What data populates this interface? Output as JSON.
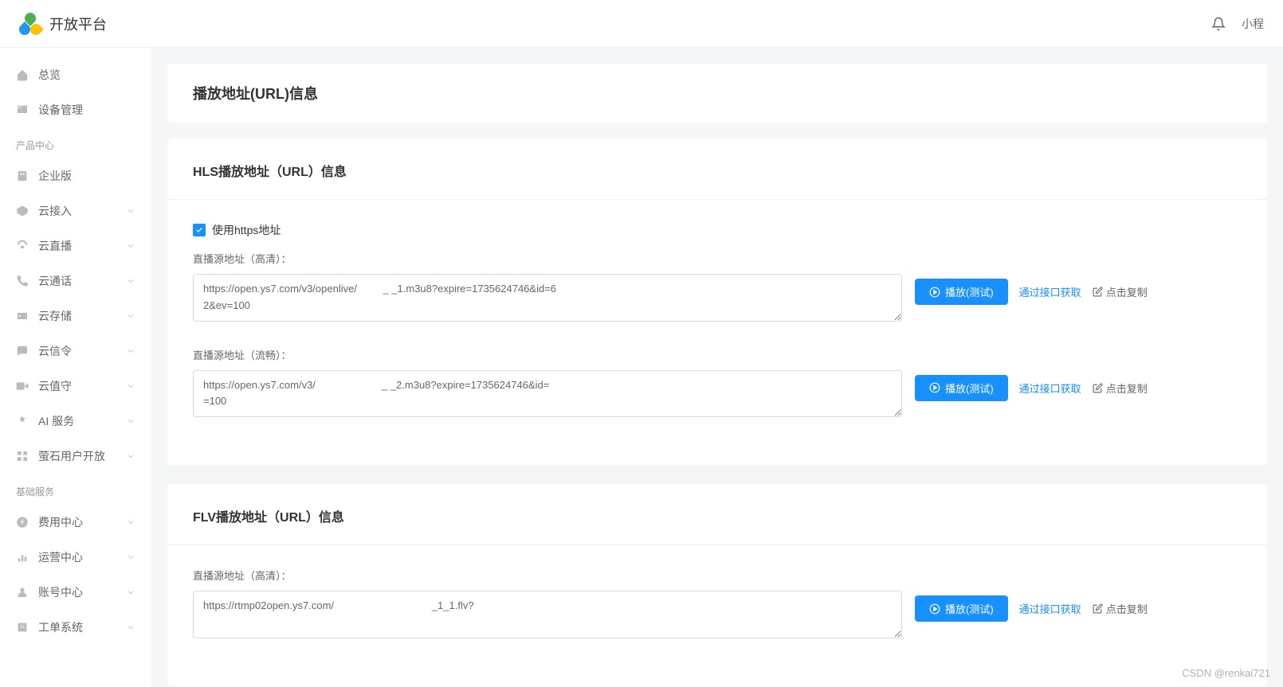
{
  "header": {
    "title": "开放平台",
    "user_text": "小程"
  },
  "sidebar": {
    "items_top": [
      {
        "icon": "home",
        "label": "总览"
      },
      {
        "icon": "device",
        "label": "设备管理"
      }
    ],
    "section1_title": "产品中心",
    "items_product": [
      {
        "icon": "enterprise",
        "label": "企业版",
        "expandable": false
      },
      {
        "icon": "cloud-access",
        "label": "云接入",
        "expandable": true
      },
      {
        "icon": "cloud-live",
        "label": "云直播",
        "expandable": true
      },
      {
        "icon": "cloud-talk",
        "label": "云通话",
        "expandable": true
      },
      {
        "icon": "cloud-storage",
        "label": "云存储",
        "expandable": true
      },
      {
        "icon": "cloud-message",
        "label": "云信令",
        "expandable": true
      },
      {
        "icon": "cloud-guard",
        "label": "云值守",
        "expandable": true
      },
      {
        "icon": "ai",
        "label": "AI 服务",
        "expandable": true
      },
      {
        "icon": "user-open",
        "label": "萤石用户开放",
        "expandable": true
      }
    ],
    "section2_title": "基础服务",
    "items_basic": [
      {
        "icon": "fee",
        "label": "费用中心",
        "expandable": true
      },
      {
        "icon": "ops",
        "label": "运营中心",
        "expandable": true
      },
      {
        "icon": "account",
        "label": "账号中心",
        "expandable": true
      },
      {
        "icon": "ticket",
        "label": "工单系统",
        "expandable": true
      }
    ]
  },
  "page": {
    "title": "播放地址(URL)信息"
  },
  "hls": {
    "title": "HLS播放地址（URL）信息",
    "checkbox_label": "使用https地址",
    "hd_label": "直播源地址（高清）：",
    "hd_url": "https://open.ys7.com/v3/openlive/         _ _1.m3u8?expire=1735624746&id=6                                                                                                                                                    2&ev=100",
    "sd_label": "直播源地址（流畅）：",
    "sd_url": "https://open.ys7.com/v3/                       _ _2.m3u8?expire=1735624746&id=                                                                                                                                                     =100"
  },
  "flv": {
    "title": "FLV播放地址（URL）信息",
    "hd_label": "直播源地址（高清）：",
    "hd_url": "https://rtmp02open.ys7.com/                                  _1_1.flv?"
  },
  "actions": {
    "play": "播放(测试)",
    "api_get": "通过接口获取",
    "copy": "点击复制"
  },
  "watermark": "CSDN @renkai721"
}
